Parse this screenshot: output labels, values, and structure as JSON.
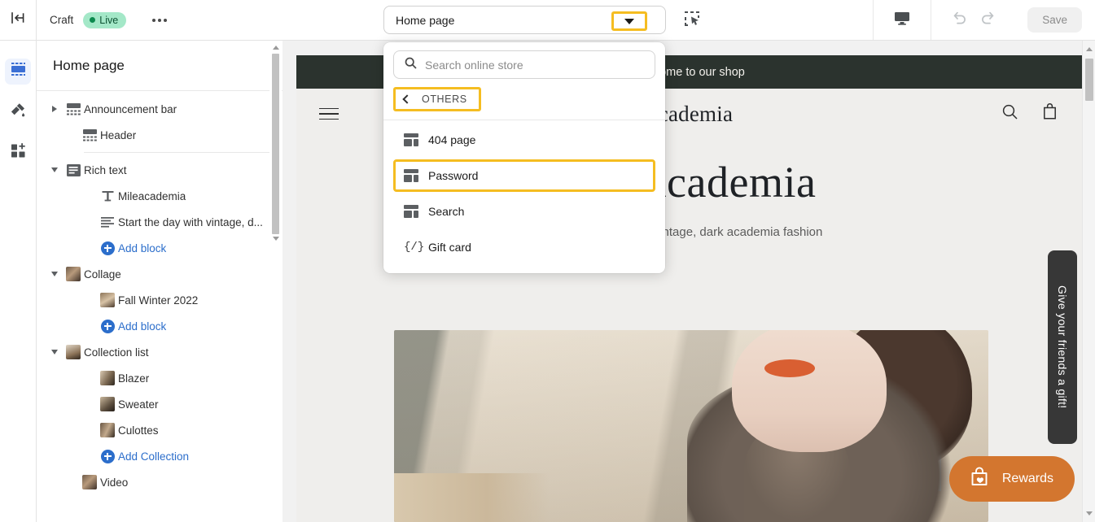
{
  "topbar": {
    "exit_icon": "exit-editor-icon",
    "craft_label": "Craft",
    "live_label": "Live",
    "more_icon": "more-options-icon",
    "page_selector_value": "Home page",
    "marquee_icon": "marquee-select-icon",
    "preview_device_icon": "desktop-preview-icon",
    "undo_icon": "undo-icon",
    "redo_icon": "redo-icon",
    "save_label": "Save"
  },
  "rail": {
    "items": [
      {
        "name": "sections-icon",
        "label": "Sections",
        "active": true
      },
      {
        "name": "theme-settings-icon",
        "label": "Theme settings",
        "active": false
      },
      {
        "name": "app-blocks-icon",
        "label": "App blocks",
        "active": false
      }
    ]
  },
  "sidebar": {
    "title": "Home page",
    "items": [
      {
        "label": "Announcement bar",
        "icon": "section-icon",
        "arrow": "right",
        "indent": 0,
        "type": "section"
      },
      {
        "label": "Header",
        "icon": "section-icon",
        "arrow": "none",
        "indent": 1,
        "type": "section"
      },
      {
        "label": "divider",
        "type": "divider"
      },
      {
        "label": "Rich text",
        "icon": "rich-text-icon",
        "arrow": "down",
        "indent": 0,
        "type": "section"
      },
      {
        "label": "Mileacademia",
        "icon": "heading-icon",
        "arrow": "none",
        "indent": 2,
        "type": "block"
      },
      {
        "label": "Start the day with vintage, d...",
        "icon": "text-block-icon",
        "arrow": "none",
        "indent": 2,
        "type": "block"
      },
      {
        "label": "Add block",
        "icon": "plus-circle-icon",
        "arrow": "none",
        "indent": 2,
        "type": "add"
      },
      {
        "label": "Collage",
        "icon": "image-thumb-icon",
        "arrow": "down",
        "indent": 0,
        "type": "section"
      },
      {
        "label": "Fall Winter 2022",
        "icon": "image-thumb-icon",
        "arrow": "none",
        "indent": 2,
        "type": "block"
      },
      {
        "label": "Add block",
        "icon": "plus-circle-icon",
        "arrow": "none",
        "indent": 2,
        "type": "add"
      },
      {
        "label": "Collection list",
        "icon": "image-thumb-icon",
        "arrow": "down",
        "indent": 0,
        "type": "section"
      },
      {
        "label": "Blazer",
        "icon": "image-thumb-icon",
        "arrow": "none",
        "indent": 2,
        "type": "block"
      },
      {
        "label": "Sweater",
        "icon": "image-thumb-icon",
        "arrow": "none",
        "indent": 2,
        "type": "block"
      },
      {
        "label": "Culottes",
        "icon": "image-thumb-icon",
        "arrow": "none",
        "indent": 2,
        "type": "block"
      },
      {
        "label": "Add Collection",
        "icon": "plus-circle-icon",
        "arrow": "none",
        "indent": 2,
        "type": "add"
      },
      {
        "label": "Video",
        "icon": "image-thumb-icon",
        "arrow": "none",
        "indent": 1,
        "type": "section"
      }
    ]
  },
  "dropdown": {
    "search_placeholder": "Search online store",
    "search_value": "",
    "search_icon": "search-icon",
    "back_label": "OTHERS",
    "back_icon": "chevron-left-icon",
    "items": [
      {
        "label": "404 page",
        "icon": "page-icon",
        "selected": false
      },
      {
        "label": "Password",
        "icon": "page-icon",
        "selected": true
      },
      {
        "label": "Search",
        "icon": "page-icon",
        "selected": false
      },
      {
        "label": "Gift card",
        "icon": "liquid-code-icon",
        "selected": false
      }
    ]
  },
  "preview": {
    "announcement_text": "Welcome to our shop",
    "menu_icon": "hamburger-menu-icon",
    "store_logo": "Mileacademia",
    "search_icon": "search-icon",
    "cart_icon": "shopping-cart-icon",
    "hero_title": "Mileacademia",
    "hero_subtitle": "Start the day with vintage, dark academia fashion",
    "gift_tab_label": "Give your friends a gift!",
    "rewards_label": "Rewards",
    "rewards_icon": "bag-heart-icon"
  },
  "colors": {
    "highlight": "#f5bd21",
    "accent_link": "#2c6ecb",
    "live_badge_bg": "#a4e8c8",
    "live_badge_text": "#0c5132",
    "announcement_bg": "#2b332e",
    "rewards_bg": "#d3762f",
    "gift_tab_bg": "#373737",
    "rail_active_bg": "#eef3fd"
  }
}
